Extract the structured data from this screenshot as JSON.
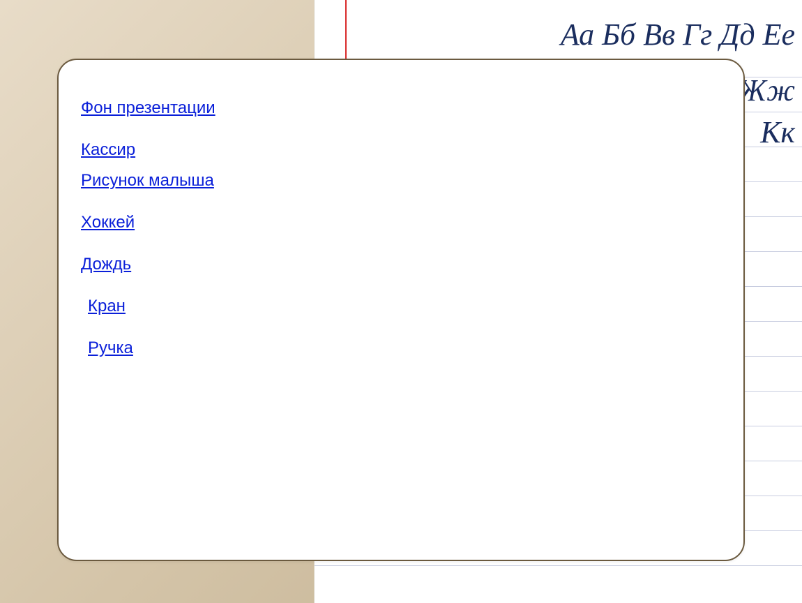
{
  "background": {
    "cursive_rows": [
      "Аа Бб Вв Гг Дд Ее",
      "Жж",
      "Кк"
    ]
  },
  "links": [
    {
      "label": "Фон презентации",
      "indent": false
    },
    {
      "label": "Кассир",
      "indent": false
    },
    {
      "label": "Рисунок малыша",
      "indent": false
    },
    {
      "label": "Хоккей",
      "indent": false
    },
    {
      "label": "Дождь",
      "indent": false
    },
    {
      "label": "Кран",
      "indent": true
    },
    {
      "label": "Ручка",
      "indent": true
    }
  ]
}
